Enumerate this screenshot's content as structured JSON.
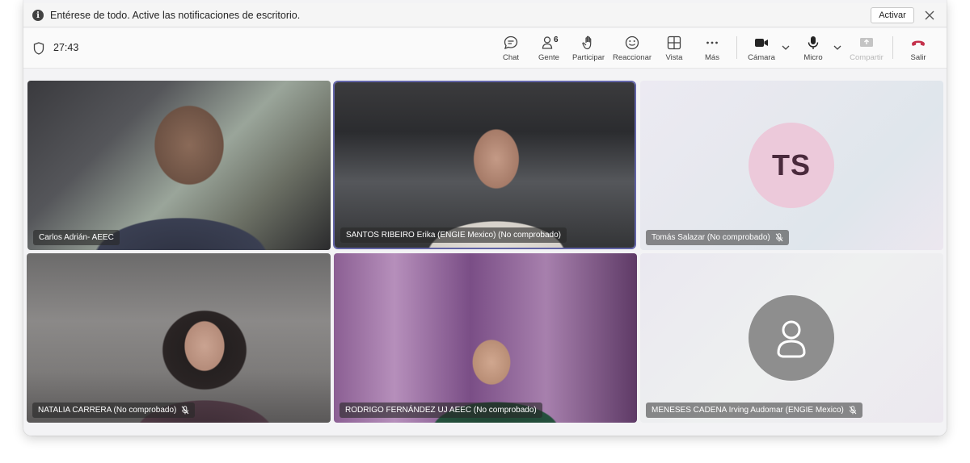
{
  "notification": {
    "text": "Entérese de todo. Active las notificaciones de escritorio.",
    "activate_label": "Activar"
  },
  "toolbar": {
    "timer": "27:43",
    "chat_label": "Chat",
    "people_label": "Gente",
    "people_count": "6",
    "raise_label": "Participar",
    "react_label": "Reaccionar",
    "view_label": "Vista",
    "more_label": "Más",
    "camera_label": "Cámara",
    "mic_label": "Micro",
    "share_label": "Compartir",
    "leave_label": "Salir"
  },
  "colors": {
    "accent": "#6264a7",
    "leave": "#c4314b",
    "avatar_ts_bg": "#ecc9da",
    "avatar_generic_bg": "#8e8e8e"
  },
  "participants": [
    {
      "name": "Carlos Adrián- AEEC",
      "muted": false,
      "video": true
    },
    {
      "name": "SANTOS RIBEIRO Erika (ENGIE Mexico) (No comprobado)",
      "muted": false,
      "video": true,
      "active_speaker": true
    },
    {
      "name": "Tomás Salazar (No comprobado)",
      "muted": true,
      "video": false,
      "initials": "TS"
    },
    {
      "name": "NATALIA CARRERA (No comprobado)",
      "muted": true,
      "video": true
    },
    {
      "name": "RODRIGO FERNÁNDEZ UJ AEEC (No comprobado)",
      "muted": false,
      "video": true
    },
    {
      "name": "MENESES CADENA Irving Audomar (ENGIE Mexico)",
      "muted": true,
      "video": false
    }
  ]
}
